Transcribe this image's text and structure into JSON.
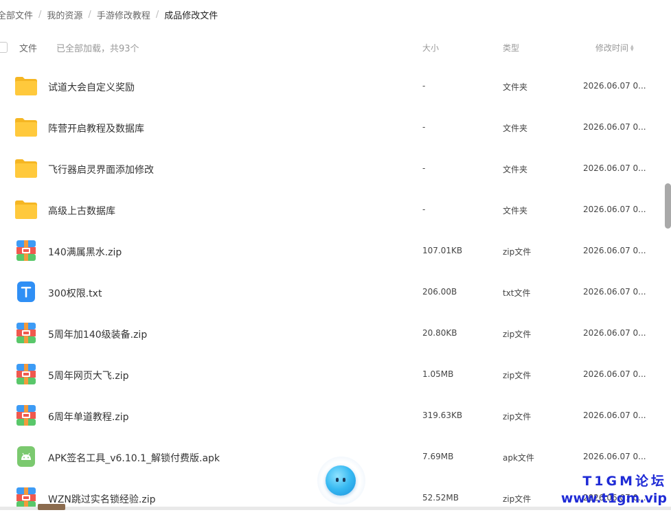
{
  "breadcrumb": {
    "items": [
      "全部文件",
      "我的资源",
      "手游修改教程",
      "成品修改文件"
    ],
    "separator": "/"
  },
  "header": {
    "name_label": "文件",
    "load_info": "已全部加载，共93个",
    "size_label": "大小",
    "type_label": "类型",
    "time_label": "修改时间"
  },
  "files": [
    {
      "name": "试道大会自定义奖励",
      "size": "-",
      "type": "文件夹",
      "time": "2026.06.07 0...",
      "icon": "folder-icon"
    },
    {
      "name": "阵营开启教程及数据库",
      "size": "-",
      "type": "文件夹",
      "time": "2026.06.07 0...",
      "icon": "folder-icon"
    },
    {
      "name": "飞行器启灵界面添加修改",
      "size": "-",
      "type": "文件夹",
      "time": "2026.06.07 0...",
      "icon": "folder-icon"
    },
    {
      "name": "高级上古数据库",
      "size": "-",
      "type": "文件夹",
      "time": "2026.06.07 0...",
      "icon": "folder-icon"
    },
    {
      "name": "140满属黑水.zip",
      "size": "107.01KB",
      "type": "zip文件",
      "time": "2026.06.07 0...",
      "icon": "zip-icon"
    },
    {
      "name": "300权限.txt",
      "size": "206.00B",
      "type": "txt文件",
      "time": "2026.06.07 0...",
      "icon": "txt-icon"
    },
    {
      "name": "5周年加140级装备.zip",
      "size": "20.80KB",
      "type": "zip文件",
      "time": "2026.06.07 0...",
      "icon": "zip-icon"
    },
    {
      "name": "5周年网页大飞.zip",
      "size": "1.05MB",
      "type": "zip文件",
      "time": "2026.06.07 0...",
      "icon": "zip-icon"
    },
    {
      "name": "6周年单道教程.zip",
      "size": "319.63KB",
      "type": "zip文件",
      "time": "2026.06.07 0...",
      "icon": "zip-icon"
    },
    {
      "name": "APK签名工具_v6.10.1_解锁付费版.apk",
      "size": "7.69MB",
      "type": "apk文件",
      "time": "2026.06.07 0...",
      "icon": "apk-icon"
    },
    {
      "name": "WZN跳过实名锁经验.zip",
      "size": "52.52MB",
      "type": "zip文件",
      "time": "2026.06.07 0...",
      "icon": "zip-icon"
    }
  ],
  "watermark": {
    "line1": "T1GM论坛",
    "line2": "www.t1gm.vip"
  },
  "colors": {
    "folder": "#FFC93C",
    "zip_blue": "#3D9BF5",
    "zip_red": "#F0584E",
    "zip_green": "#59C76A",
    "txt": "#2F8FF5",
    "apk": "#7BC96F",
    "watermark": "#1F2BD6"
  }
}
